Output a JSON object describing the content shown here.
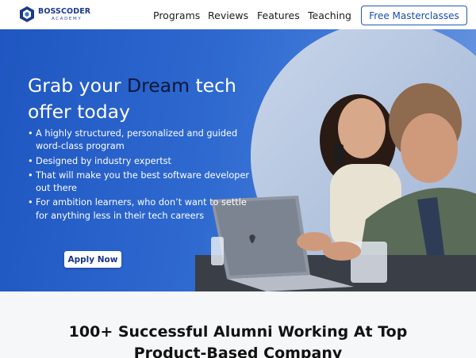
{
  "brand": {
    "name": "BOSSCODER",
    "sub": "ACADEMY",
    "colors": {
      "primary": "#1b3a8a",
      "accent": "#2357b8"
    }
  },
  "nav": {
    "links": [
      "Programs",
      "Reviews",
      "Features",
      "Teaching"
    ],
    "cta": "Free Masterclasses"
  },
  "hero": {
    "headline_pre": "Grab your ",
    "headline_highlight": "Dream",
    "headline_post": " tech offer today",
    "bullets": [
      "A highly structured, personalized and guided word-class program",
      "Designed by industry expertst",
      "That will make you the best software developer out there",
      "For ambition learners, who don’t want to settle for anything less in their tech careers"
    ],
    "apply": "Apply Now",
    "image": "couple-laptop-photo",
    "gradient": [
      "#1f56c1",
      "#6e99e0"
    ]
  },
  "alumni": {
    "title": "100+ Successful Alumni Working At Top Product-Based Company"
  }
}
